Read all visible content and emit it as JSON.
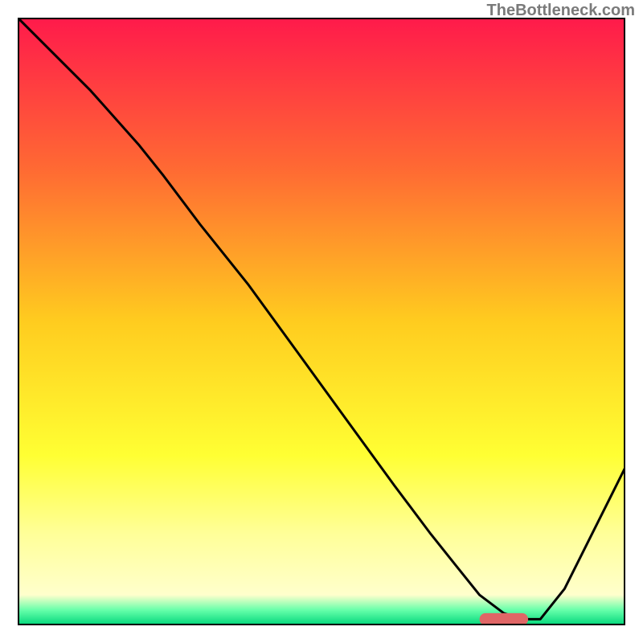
{
  "watermark": "TheBottleneck.com",
  "chart_data": {
    "type": "line",
    "title": "",
    "xlabel": "",
    "ylabel": "",
    "xlim": [
      0,
      100
    ],
    "ylim": [
      0,
      100
    ],
    "grid": false,
    "legend": false,
    "background": {
      "type": "vertical-gradient",
      "stops": [
        {
          "pos": 0.0,
          "color": "#ff1a4b"
        },
        {
          "pos": 0.25,
          "color": "#ff6a33"
        },
        {
          "pos": 0.5,
          "color": "#ffcc1f"
        },
        {
          "pos": 0.72,
          "color": "#ffff33"
        },
        {
          "pos": 0.85,
          "color": "#ffff99"
        },
        {
          "pos": 0.95,
          "color": "#ffffcc"
        },
        {
          "pos": 0.975,
          "color": "#66ffaa"
        },
        {
          "pos": 1.0,
          "color": "#00d67a"
        }
      ]
    },
    "series": [
      {
        "name": "curve",
        "stroke": "#000000",
        "x": [
          0,
          5,
          12,
          20,
          24,
          30,
          38,
          46,
          54,
          62,
          68,
          72,
          76,
          80,
          83,
          86,
          90,
          94,
          98,
          100
        ],
        "y": [
          100,
          95,
          88,
          79,
          74,
          66,
          56,
          45,
          34,
          23,
          15,
          10,
          5,
          2,
          1,
          1,
          6,
          14,
          22,
          26
        ]
      }
    ],
    "marker": {
      "name": "target-bar",
      "shape": "rounded-bar",
      "color": "#e06666",
      "x_center": 80,
      "y": 1,
      "width": 8,
      "height": 2
    }
  }
}
